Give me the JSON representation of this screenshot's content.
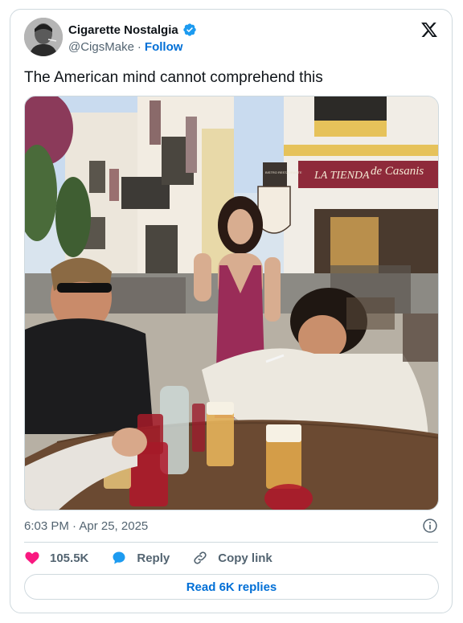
{
  "author": {
    "display_name": "Cigarette Nostalgia",
    "handle": "@CigsMake",
    "separator": "·",
    "follow_label": "Follow",
    "verified": true
  },
  "tweet": {
    "text": "The American mind cannot comprehend this",
    "timestamp": "6:03 PM · Apr 25, 2025"
  },
  "media": {
    "storefront_sign": "LA TIENDA",
    "script_sign": "de Casanis",
    "bistro_sign": "BISTRO RESTAURANTE"
  },
  "actions": {
    "like_count": "105.5K",
    "reply_label": "Reply",
    "copy_link_label": "Copy link"
  },
  "footer": {
    "read_replies_label": "Read 6K replies"
  },
  "colors": {
    "accent": "#006fd6",
    "like": "#f91880",
    "verified": "#1d9bf0",
    "border": "#cfd9de",
    "muted": "#536471"
  },
  "icons": [
    "x-logo-icon",
    "verified-badge-icon",
    "info-icon",
    "heart-icon",
    "reply-bubble-icon",
    "link-icon"
  ]
}
